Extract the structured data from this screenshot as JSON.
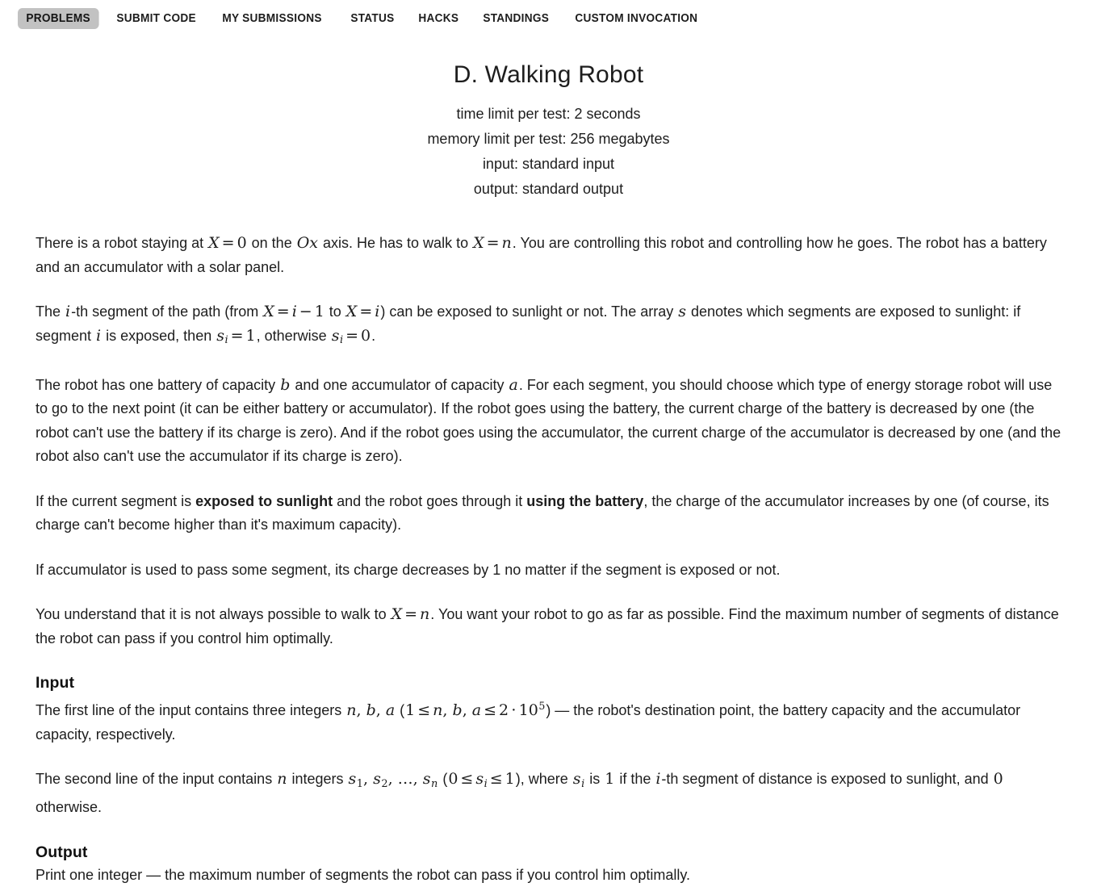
{
  "nav": {
    "items": [
      {
        "label": "PROBLEMS",
        "active": true
      },
      {
        "label": "SUBMIT CODE",
        "active": false
      },
      {
        "label": "MY SUBMISSIONS",
        "active": false
      },
      {
        "label": "STATUS",
        "active": false
      },
      {
        "label": "HACKS",
        "active": false
      },
      {
        "label": "STANDINGS",
        "active": false
      },
      {
        "label": "CUSTOM INVOCATION",
        "active": false
      }
    ],
    "active_background": "#c2c2c2"
  },
  "problem": {
    "title": "D. Walking Robot",
    "time_limit": "time limit per test: 2 seconds",
    "memory_limit": "memory limit per test: 256 megabytes",
    "input_spec": "input: standard input",
    "output_spec": "output: standard output"
  },
  "statement": {
    "p1": {
      "t1": "There is a robot staying at ",
      "m1_X": "X",
      "m1_eq": "=",
      "m1_0": "0",
      "t2": " on the ",
      "m2_O": "O",
      "m2_x": "x",
      "t3": " axis. He has to walk to ",
      "m3_X": "X",
      "m3_eq": "=",
      "m3_n": "n",
      "t4": ". You are controlling this robot and controlling how he goes. The robot has a battery and an accumulator with a solar panel."
    },
    "p2": {
      "t1": "The ",
      "m1_i": "i",
      "t2": "-th segment of the path (from ",
      "m2_X": "X",
      "m2_eq": "=",
      "m2_i": "i",
      "m2_minus": "−",
      "m2_1": "1",
      "t3": " to ",
      "m3_X": "X",
      "m3_eq": "=",
      "m3_i": "i",
      "t4": ") can be exposed to sunlight or not. The array ",
      "m4_s": "s",
      "t5": " denotes which segments are exposed to sunlight: if segment ",
      "m5_i": "i",
      "t6": " is exposed, then ",
      "m6_s": "s",
      "m6_sub": "i",
      "m6_eq": "=",
      "m6_1": "1",
      "t7": ", otherwise ",
      "m7_s": "s",
      "m7_sub": "i",
      "m7_eq": "=",
      "m7_0": "0",
      "t8": "."
    },
    "p3": {
      "t1": "The robot has one battery of capacity ",
      "m1_b": "b",
      "t2": " and one accumulator of capacity ",
      "m2_a": "a",
      "t3": ". For each segment, you should choose which type of energy storage robot will use to go to the next point (it can be either battery or accumulator). If the robot goes using the battery, the current charge of the battery is decreased by one (the robot can't use the battery if its charge is zero). And if the robot goes using the accumulator, the current charge of the accumulator is decreased by one (and the robot also can't use the accumulator if its charge is zero)."
    },
    "p4": {
      "t1": "If the current segment is ",
      "b1": "exposed to sunlight",
      "t2": " and the robot goes through it ",
      "b2": "using the battery",
      "t3": ", the charge of the accumulator increases by one (of course, its charge can't become higher than it's maximum capacity)."
    },
    "p5": {
      "t1": "If accumulator is used to pass some segment, its charge decreases by 1 no matter if the segment is exposed or not."
    },
    "p6": {
      "t1": "You understand that it is not always possible to walk to ",
      "m1_X": "X",
      "m1_eq": "=",
      "m1_n": "n",
      "t2": ". You want your robot to go as far as possible. Find the maximum number of segments of distance the robot can pass if you control him optimally."
    }
  },
  "input_section": {
    "heading": "Input",
    "p1": {
      "t1": "The first line of the input contains three integers ",
      "m1_n": "n",
      "m1_c1": ",",
      "m1_b": "b",
      "m1_c2": ",",
      "m1_a": "a",
      "t2": " (",
      "m2_1": "1",
      "m2_le1": "≤",
      "m2_n": "n",
      "m2_c1": ",",
      "m2_b": "b",
      "m2_c2": ",",
      "m2_a": "a",
      "m2_le2": "≤",
      "m2_2": "2",
      "m2_dot": "⋅",
      "m2_10": "10",
      "m2_exp": "5",
      "t3": ") — the robot's destination point, the battery capacity and the accumulator capacity, respectively."
    },
    "p2": {
      "t1": "The second line of the input contains ",
      "m1_n": "n",
      "t2": " integers ",
      "m2_s1": "s",
      "m2_sub1": "1",
      "m2_c1": ",",
      "m2_s2": "s",
      "m2_sub2": "2",
      "m2_c2": ",",
      "m2_dots": "…",
      "m2_c3": ",",
      "m2_sn": "s",
      "m2_subn": "n",
      "t3": " (",
      "m3_0": "0",
      "m3_le1": "≤",
      "m3_s": "s",
      "m3_sub": "i",
      "m3_le2": "≤",
      "m3_1": "1",
      "t4": "), where ",
      "m4_s": "s",
      "m4_sub": "i",
      "t5": " is ",
      "m5_1": "1",
      "t6": " if the ",
      "m6_i": "i",
      "t7": "-th segment of distance is exposed to sunlight, and ",
      "m7_0": "0",
      "t8": " otherwise."
    }
  },
  "output_section": {
    "heading": "Output",
    "p1": "Print one integer — the maximum number of segments the robot can pass if you control him optimally."
  }
}
